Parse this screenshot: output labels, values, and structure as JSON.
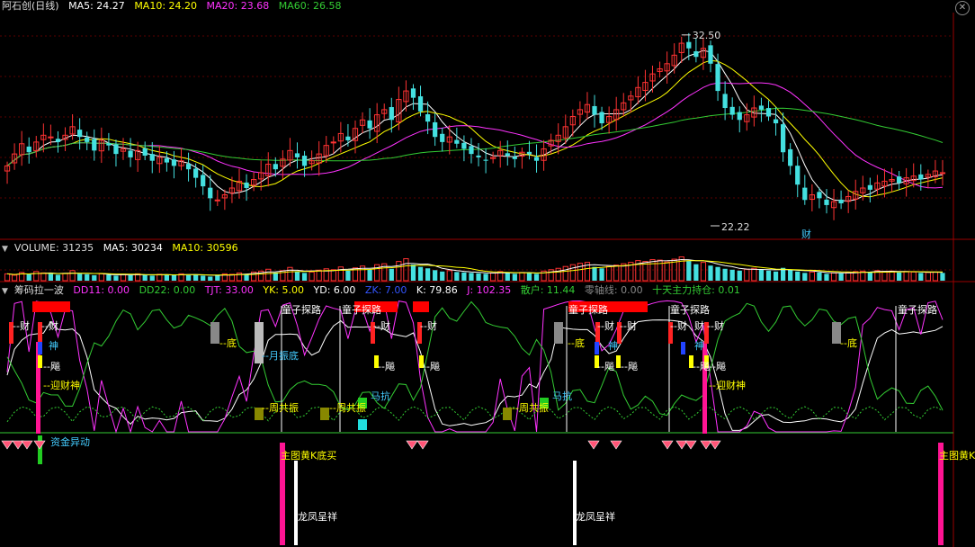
{
  "main_panel": {
    "title": "阿石创(日线)",
    "ma": [
      {
        "label": "MA5: 24.27",
        "color": "#ffffff"
      },
      {
        "label": "MA10: 24.20",
        "color": "#ffff00"
      },
      {
        "label": "MA20: 23.68",
        "color": "#ff33ff"
      },
      {
        "label": "MA60: 26.58",
        "color": "#33cc33"
      }
    ],
    "high_label": "32.50",
    "low_label": "22.22",
    "cai_label": "财",
    "close_icon": "close-circle-icon"
  },
  "volume_panel": {
    "labels": [
      {
        "label": "VOLUME: 31235",
        "color": "#dddddd"
      },
      {
        "label": "MA5: 30234",
        "color": "#ffffff"
      },
      {
        "label": "MA10: 30596",
        "color": "#ffff00"
      }
    ]
  },
  "indicator_panel": {
    "title": "筹码拉一波",
    "labels": [
      {
        "label": "DD11: 0.00",
        "color": "#ff33ff"
      },
      {
        "label": "DD22: 0.00",
        "color": "#33cc33"
      },
      {
        "label": "TJT: 33.00",
        "color": "#ff33ff"
      },
      {
        "label": "YK: 5.00",
        "color": "#ffff00"
      },
      {
        "label": "YD: 6.00",
        "color": "#ffffff"
      },
      {
        "label": "ZK: 7.00",
        "color": "#3355ff"
      },
      {
        "label": "K: 79.86",
        "color": "#ffffff"
      },
      {
        "label": "J: 102.35",
        "color": "#ff33ff"
      },
      {
        "label": "散户: 11.44",
        "color": "#33cc33"
      },
      {
        "label": "零轴线: 0.00",
        "color": "#888888"
      },
      {
        "label": "十天主力持仓: 0.01",
        "color": "#33cc33"
      }
    ],
    "annotations": [
      {
        "text": "童子探路",
        "x": 313,
        "y": 348,
        "color": "#ffffff"
      },
      {
        "text": "童子探路",
        "x": 380,
        "y": 348,
        "color": "#ffffff"
      },
      {
        "text": "童子探路",
        "x": 632,
        "y": 348,
        "color": "#ffffff"
      },
      {
        "text": "童子探路",
        "x": 745,
        "y": 348,
        "color": "#ffffff"
      },
      {
        "text": "童子探路",
        "x": 998,
        "y": 348,
        "color": "#ffffff"
      },
      {
        "text": "--财",
        "x": 14,
        "y": 366,
        "color": "#ffffff"
      },
      {
        "text": "--财",
        "x": 46,
        "y": 366,
        "color": "#ffffff"
      },
      {
        "text": "--财",
        "x": 415,
        "y": 366,
        "color": "#ffffff"
      },
      {
        "text": "--财",
        "x": 467,
        "y": 366,
        "color": "#ffffff"
      },
      {
        "text": "--财",
        "x": 664,
        "y": 366,
        "color": "#ffffff"
      },
      {
        "text": "--财",
        "x": 689,
        "y": 366,
        "color": "#ffffff"
      },
      {
        "text": "--财",
        "x": 745,
        "y": 366,
        "color": "#ffffff"
      },
      {
        "text": "财",
        "x": 772,
        "y": 366,
        "color": "#ffffff"
      },
      {
        "text": "--财",
        "x": 786,
        "y": 366,
        "color": "#ffffff"
      },
      {
        "text": "神",
        "x": 54,
        "y": 388,
        "color": "#44ccff"
      },
      {
        "text": "神",
        "x": 676,
        "y": 388,
        "color": "#44ccff"
      },
      {
        "text": "神",
        "x": 772,
        "y": 388,
        "color": "#44ccff"
      },
      {
        "text": "--底",
        "x": 244,
        "y": 385,
        "color": "#ffff00"
      },
      {
        "text": "--底",
        "x": 631,
        "y": 385,
        "color": "#ffff00"
      },
      {
        "text": "--底",
        "x": 934,
        "y": 385,
        "color": "#ffff00"
      },
      {
        "text": "--月振底",
        "x": 291,
        "y": 399,
        "color": "#44ccff"
      },
      {
        "text": "--飚",
        "x": 48,
        "y": 411,
        "color": "#ffffff"
      },
      {
        "text": "--飚",
        "x": 420,
        "y": 411,
        "color": "#ffffff"
      },
      {
        "text": "--飚",
        "x": 470,
        "y": 411,
        "color": "#ffffff"
      },
      {
        "text": "--飚",
        "x": 664,
        "y": 411,
        "color": "#ffffff"
      },
      {
        "text": "--飚",
        "x": 690,
        "y": 411,
        "color": "#ffffff"
      },
      {
        "text": "--飚",
        "x": 770,
        "y": 411,
        "color": "#ffffff"
      },
      {
        "text": "--飚",
        "x": 788,
        "y": 411,
        "color": "#ffffff"
      },
      {
        "text": "--迎财神",
        "x": 48,
        "y": 432,
        "color": "#ffff00"
      },
      {
        "text": "--迎财神",
        "x": 788,
        "y": 432,
        "color": "#ffff00"
      },
      {
        "text": "马抗",
        "x": 412,
        "y": 444,
        "color": "#44ccff"
      },
      {
        "text": "马抗",
        "x": 614,
        "y": 444,
        "color": "#44ccff"
      },
      {
        "text": "--周共振",
        "x": 291,
        "y": 457,
        "color": "#ffff00"
      },
      {
        "text": "--周共振",
        "x": 366,
        "y": 457,
        "color": "#ffff00"
      },
      {
        "text": "--周共振",
        "x": 569,
        "y": 457,
        "color": "#ffff00"
      },
      {
        "text": "资金异动",
        "x": 56,
        "y": 495,
        "color": "#44ccff"
      }
    ]
  },
  "signal_panel": {
    "annotations": [
      {
        "text": "主图黄K底买",
        "x": 312,
        "y": 510,
        "color": "#ffff00"
      },
      {
        "text": "主图黄K底买",
        "x": 1044,
        "y": 510,
        "color": "#ffff00"
      },
      {
        "text": "龙凤呈祥",
        "x": 331,
        "y": 578,
        "color": "#ffffff"
      },
      {
        "text": "龙凤呈祥",
        "x": 640,
        "y": 578,
        "color": "#ffffff"
      }
    ]
  },
  "chart_data": {
    "type": "candlestick",
    "series": [
      {
        "name": "MA5",
        "values": [],
        "color": "#ffffff"
      },
      {
        "name": "MA10",
        "values": [],
        "color": "#ffff00"
      },
      {
        "name": "MA20",
        "values": [],
        "color": "#ff33ff"
      },
      {
        "name": "MA60",
        "values": [],
        "color": "#33cc33"
      }
    ],
    "price_high": 32.5,
    "price_low": 22.22,
    "ylim": [
      20.5,
      33.6
    ],
    "closes": [
      24.6,
      25.3,
      25.9,
      25.4,
      26.0,
      26.4,
      26.3,
      26.0,
      26.4,
      26.9,
      26.3,
      26.0,
      25.5,
      26.1,
      25.8,
      25.3,
      25.6,
      25.1,
      25.5,
      25.2,
      24.9,
      25.1,
      24.8,
      24.6,
      24.9,
      24.4,
      23.9,
      23.4,
      22.7,
      22.6,
      22.9,
      23.3,
      23.7,
      23.3,
      23.8,
      24.2,
      24.7,
      24.4,
      25.0,
      25.5,
      25.1,
      24.6,
      24.9,
      25.3,
      25.8,
      26.0,
      26.5,
      26.1,
      26.8,
      27.3,
      26.8,
      27.6,
      27.9,
      27.3,
      28.5,
      29.0,
      28.6,
      27.8,
      27.2,
      26.3,
      26.0,
      26.3,
      25.9,
      25.6,
      25.3,
      25.1,
      24.9,
      25.1,
      25.5,
      25.2,
      25.0,
      25.4,
      25.3,
      24.9,
      25.6,
      26.1,
      26.4,
      26.9,
      27.5,
      27.9,
      28.2,
      27.6,
      27.1,
      27.5,
      27.9,
      28.3,
      28.7,
      29.2,
      29.5,
      30.0,
      30.3,
      30.6,
      31.1,
      31.8,
      31.5,
      31.0,
      31.5,
      30.6,
      29.0,
      28.0,
      27.6,
      27.3,
      27.6,
      28.0,
      27.9,
      27.5,
      27.1,
      25.4,
      24.6,
      23.5,
      22.6,
      22.9,
      22.7,
      22.3,
      22.5,
      22.4,
      22.8,
      23.1,
      23.3,
      23.2,
      23.6,
      23.7,
      23.8,
      23.6,
      23.9,
      24.0,
      23.8,
      24.1,
      24.3,
      24.2
    ],
    "volumes": [
      30,
      24,
      36,
      28,
      40,
      34,
      30,
      26,
      32,
      44,
      30,
      28,
      24,
      30,
      26,
      22,
      28,
      24,
      30,
      26,
      22,
      28,
      26,
      24,
      30,
      24,
      28,
      22,
      18,
      26,
      30,
      28,
      34,
      28,
      38,
      42,
      50,
      36,
      44,
      58,
      40,
      34,
      38,
      46,
      52,
      48,
      60,
      44,
      56,
      64,
      48,
      70,
      74,
      52,
      84,
      96,
      70,
      60,
      54,
      46,
      40,
      44,
      38,
      36,
      34,
      32,
      30,
      34,
      40,
      36,
      30,
      36,
      34,
      30,
      42,
      48,
      54,
      62,
      70,
      76,
      80,
      60,
      54,
      62,
      68,
      74,
      80,
      88,
      84,
      92,
      90,
      82,
      94,
      104,
      86,
      72,
      80,
      66,
      60,
      52,
      48,
      44,
      50,
      54,
      50,
      44,
      40,
      56,
      48,
      40,
      34,
      38,
      36,
      30,
      34,
      32,
      36,
      40,
      42,
      38,
      44,
      40,
      42,
      36,
      40,
      38,
      34,
      36,
      38,
      34
    ],
    "volume_ylim": [
      0,
      110
    ]
  }
}
